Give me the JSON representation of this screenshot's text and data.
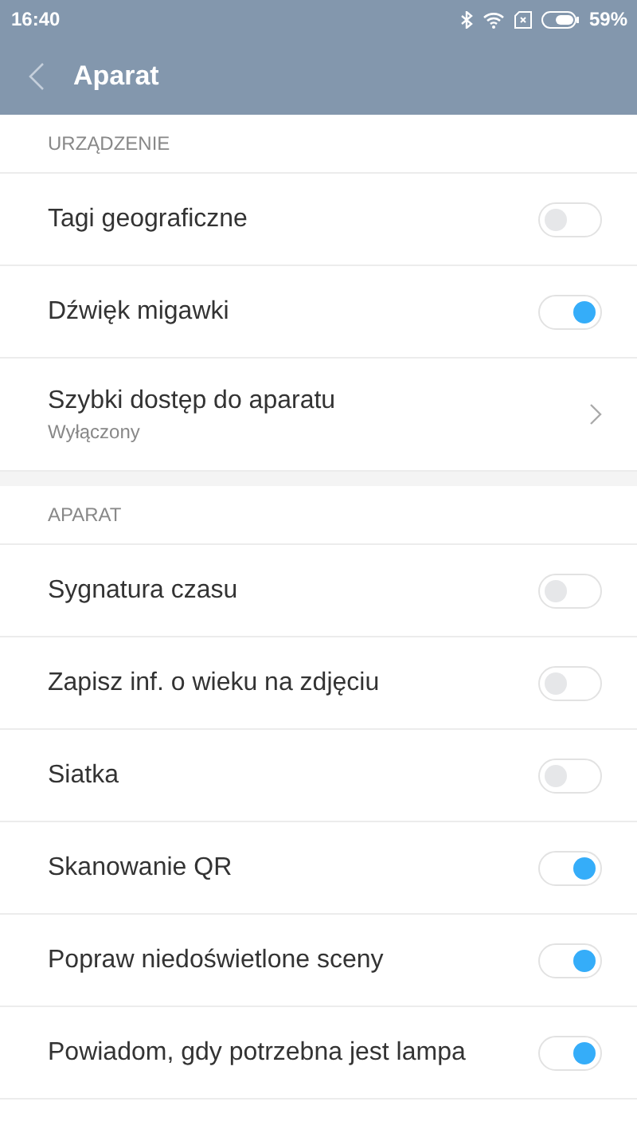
{
  "status_bar": {
    "time": "16:40",
    "battery": "59%"
  },
  "header": {
    "title": "Aparat"
  },
  "sections": [
    {
      "title": "URZĄDZENIE",
      "items": [
        {
          "kind": "toggle",
          "label": "Tagi geograficzne",
          "on": false
        },
        {
          "kind": "toggle",
          "label": "Dźwięk migawki",
          "on": true
        },
        {
          "kind": "link",
          "label": "Szybki dostęp do aparatu",
          "value": "Wyłączony"
        }
      ]
    },
    {
      "title": "APARAT",
      "items": [
        {
          "kind": "toggle",
          "label": "Sygnatura czasu",
          "on": false
        },
        {
          "kind": "toggle",
          "label": "Zapisz inf. o wieku na zdjęciu",
          "on": false
        },
        {
          "kind": "toggle",
          "label": "Siatka",
          "on": false
        },
        {
          "kind": "toggle",
          "label": "Skanowanie QR",
          "on": true
        },
        {
          "kind": "toggle",
          "label": "Popraw niedoświetlone sceny",
          "on": true
        },
        {
          "kind": "toggle",
          "label": "Powiadom, gdy potrzebna jest lampa",
          "on": true
        }
      ]
    }
  ]
}
